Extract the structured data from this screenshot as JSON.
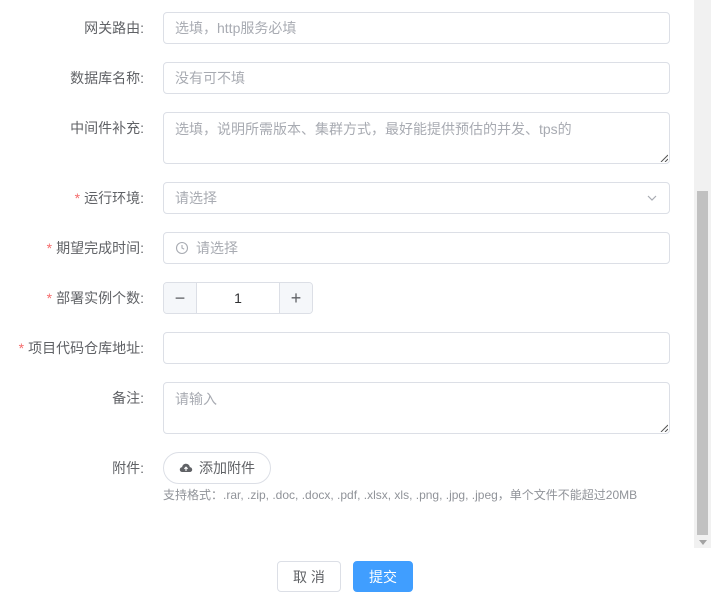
{
  "fields": {
    "gateway_route": {
      "label": "网关路由:",
      "placeholder": "选填，http服务必填"
    },
    "db_name": {
      "label": "数据库名称:",
      "placeholder": "没有可不填"
    },
    "middleware": {
      "label": "中间件补充:",
      "placeholder": "选填，说明所需版本、集群方式，最好能提供预估的并发、tps的"
    },
    "env": {
      "label": "运行环境:",
      "placeholder": "请选择",
      "required": "*"
    },
    "deadline": {
      "label": "期望完成时间:",
      "placeholder": "请选择",
      "required": "*"
    },
    "instances": {
      "label": "部署实例个数:",
      "value": "1",
      "minus": "−",
      "plus": "+",
      "required": "*"
    },
    "repo": {
      "label": "项目代码仓库地址:",
      "placeholder": "",
      "required": "*"
    },
    "remarks": {
      "label": "备注:",
      "placeholder": "请输入"
    },
    "attachment": {
      "label": "附件:",
      "button": "添加附件",
      "hint": "支持格式：.rar, .zip, .doc, .docx, .pdf, .xlsx, xls, .png, .jpg, .jpeg，单个文件不能超过20MB"
    }
  },
  "footer": {
    "cancel": "取 消",
    "submit": "提交"
  },
  "icons": {
    "select_arrow": "chevron-down-icon",
    "clock": "clock-icon",
    "upload": "cloud-upload-icon"
  },
  "colors": {
    "primary": "#409eff",
    "required": "#f56c6c",
    "border": "#dcdfe6"
  }
}
